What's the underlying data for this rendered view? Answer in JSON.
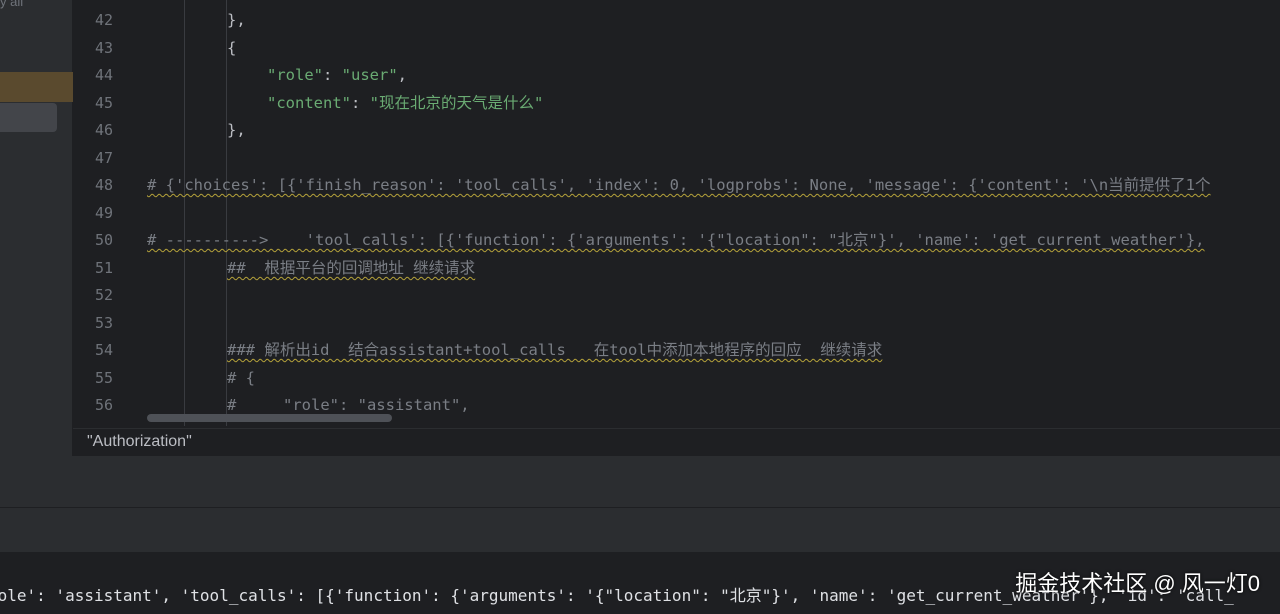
{
  "sidebar": {
    "top_text": "y all"
  },
  "editor": {
    "lines": [
      {
        "num": "42",
        "text": "},"
      },
      {
        "num": "43",
        "text": "{"
      },
      {
        "num": "44",
        "key": "\"role\"",
        "sep": ": ",
        "val": "\"user\"",
        "tail": ","
      },
      {
        "num": "45",
        "key": "\"content\"",
        "sep": ": ",
        "val": "\"现在北京的天气是什么\"",
        "tail": ""
      },
      {
        "num": "46",
        "text": "},"
      },
      {
        "num": "47",
        "text": ""
      },
      {
        "num": "48",
        "text": "# {'choices': [{'finish_reason': 'tool_calls', 'index': 0, 'logprobs': None, 'message': {'content': '\\n当前提供了1个"
      },
      {
        "num": "49",
        "text": ""
      },
      {
        "num": "50",
        "text": "# ---------->    'tool_calls': [{'function': {'arguments': '{\"location\": \"北京\"}', 'name': 'get_current_weather'},"
      },
      {
        "num": "51",
        "text": "##  根据平台的回调地址 继续请求"
      },
      {
        "num": "52",
        "text": ""
      },
      {
        "num": "53",
        "text": ""
      },
      {
        "num": "54",
        "text": "### 解析出id  结合assistant+tool_calls   在tool中添加本地程序的回应  继续请求"
      },
      {
        "num": "55",
        "text": "# {"
      },
      {
        "num": "56",
        "text": "#     \"role\": \"assistant\","
      }
    ]
  },
  "tooltip": {
    "text": "\"Authorization\""
  },
  "console": {
    "text": "role': 'assistant', 'tool_calls': [{'function': {'arguments': '{\"location\": \"北京\"}', 'name': 'get_current_weather'}, 'id': 'call_"
  },
  "watermark": {
    "text": "掘金技术社区 @ 风一灯0"
  },
  "colors": {
    "background": "#1e1f22",
    "panel": "#2b2d30",
    "string": "#6aab73",
    "comment": "#7a7e85",
    "text": "#bcbec4",
    "warning_underline": "#b5a23a",
    "sidebar_highlight": "#5a4a2e"
  }
}
